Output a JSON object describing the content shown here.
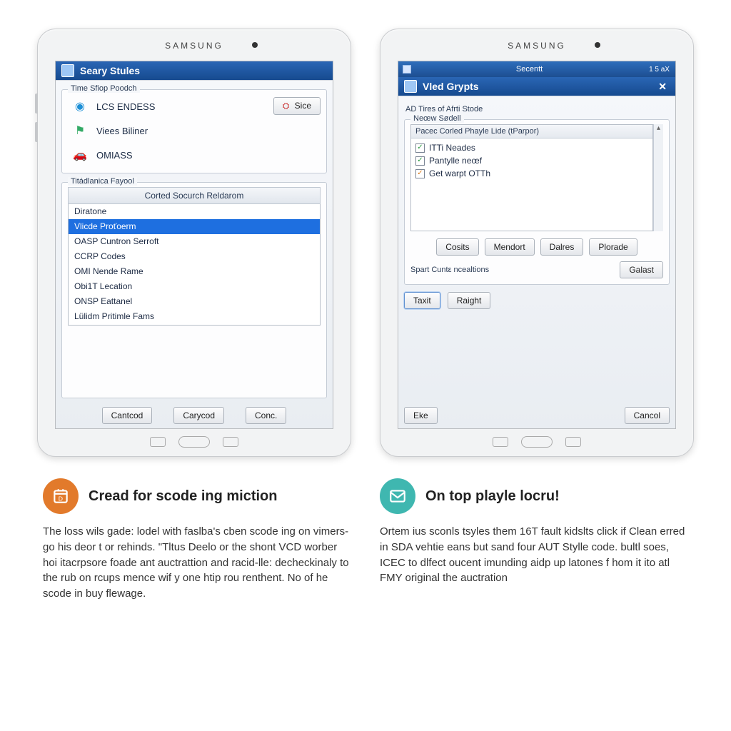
{
  "tablet_brand": "SAMSUNG",
  "left": {
    "window_title": "Seary Stules",
    "group1_legend": "Time Sfiop Poodch",
    "items": [
      {
        "label": "LCS ENDESS"
      },
      {
        "label": "Viees Biliner"
      },
      {
        "label": "OMIASS"
      }
    ],
    "side_button_label": "Sice",
    "group2_legend": "Titádlanica Fayool",
    "list_header": "Corted Socurch Reldarom",
    "list": [
      "Diratone",
      "Vlicde Proťoerm",
      "OASP Cuntron Serroft",
      "CCRP Codes",
      "OMI Nende Rame",
      "Obi1T Lecation",
      "ONSP Eattanel",
      "Lülidm Pritimle Fams"
    ],
    "list_selected_index": 1,
    "buttons": {
      "left": "Cantcod",
      "middle": "Carycod",
      "right": "Conc."
    }
  },
  "right": {
    "titlebar_center": "Secentt",
    "titlebar_right": "1 5 aX",
    "window_title": "Vled Grypts",
    "subtitle": "AD Tires of Afrti Stode",
    "group_legend": "Neœw Sødell",
    "check_header_left": "Pacec Corled Phayle Lide (tParpor)",
    "check_items": [
      {
        "label": "ITTi Neades",
        "variant": "green"
      },
      {
        "label": "Pantylle neœf",
        "variant": "green"
      },
      {
        "label": "Get warpt OTTh",
        "variant": "orange"
      }
    ],
    "row1": [
      "Cosits",
      "Mendort",
      "Dalres",
      "Plorade"
    ],
    "spart_label": "Spart Cuntε ncealtions",
    "galast": "Galast",
    "row2": [
      "Taxit",
      "Raight"
    ],
    "bottom": {
      "left": "Eke",
      "right": "Cancol"
    }
  },
  "columns": {
    "left": {
      "title": "Cread for scode ing miction",
      "body": "The loss wils gade: lodel with faslba's cben scode ing on vimers-go his deor t or rehinds. \"Tltus Deelo or the shont VCD worber hoi itacrpsore foade ant auctrattion and racid-lle: decheckinaly to the rub on rcups mence wif y one htip rou renthent. No of he scode in buy flewage."
    },
    "right": {
      "title": "On top playle locru!",
      "body": "Ortem ius sconls tsyles them 16T fault kidslts click if Clean erred in SDA vehtie eans but sand four AUT Stylle code. bultl soes, ICEC to dlfect oucent imunding aidp up latones f hom it ito atl FMY original the auctration"
    }
  }
}
